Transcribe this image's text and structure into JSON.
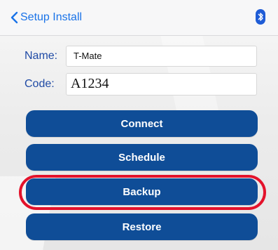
{
  "nav": {
    "back_label": "Setup Install",
    "bluetooth_icon": "bluetooth-icon",
    "back_icon": "chevron-left-icon"
  },
  "form": {
    "name_label": "Name:",
    "name_value": "T-Mate",
    "code_label": "Code:",
    "code_value": "A1234"
  },
  "buttons": {
    "connect": "Connect",
    "schedule": "Schedule",
    "backup": "Backup",
    "restore": "Restore"
  },
  "colors": {
    "accent": "#1a73e8",
    "button_bg": "#0f4d97",
    "highlight": "#e3122b"
  }
}
